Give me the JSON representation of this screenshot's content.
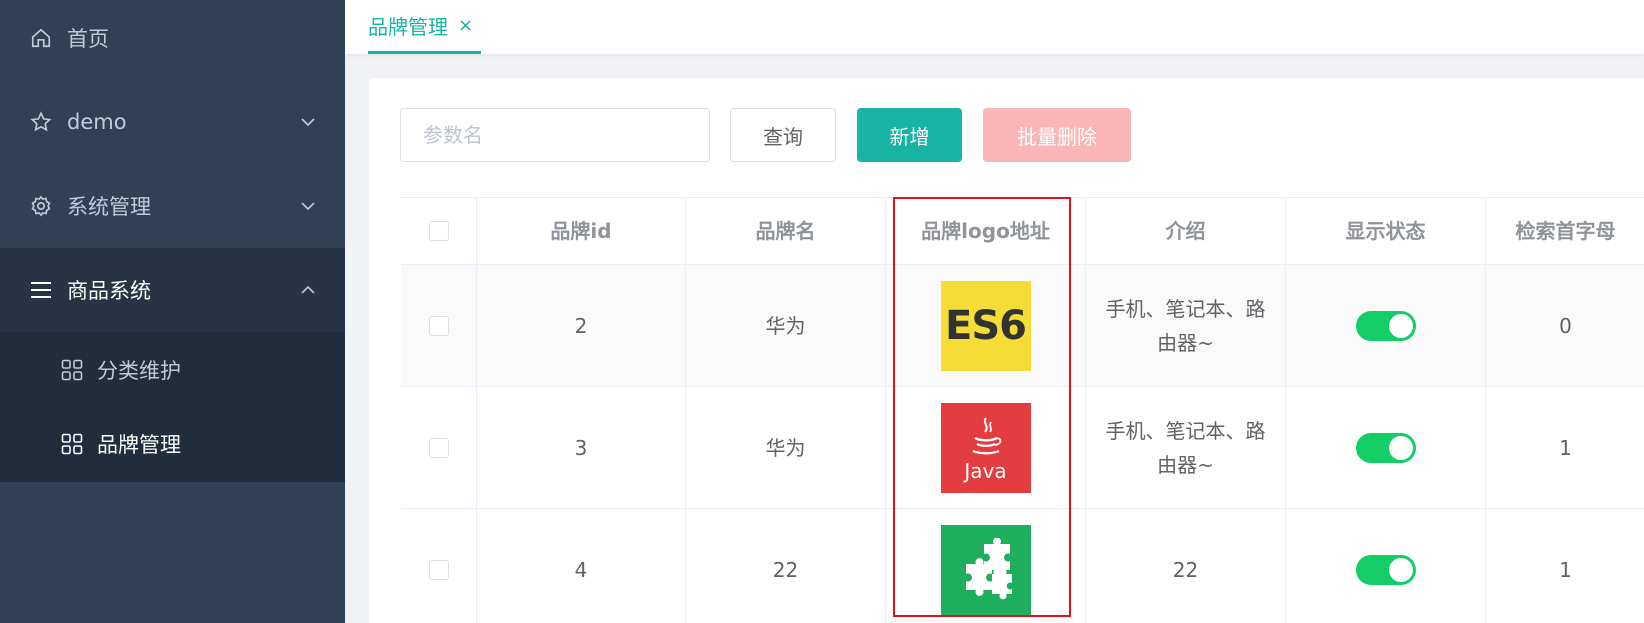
{
  "sidebar": {
    "items": [
      {
        "label": "首页",
        "icon": "home-icon"
      },
      {
        "label": "demo",
        "icon": "star-icon"
      },
      {
        "label": "系统管理",
        "icon": "gear-icon"
      },
      {
        "label": "商品系统",
        "icon": "menu-icon"
      }
    ],
    "subitems": [
      {
        "label": "分类维护",
        "icon": "grid-icon"
      },
      {
        "label": "品牌管理",
        "icon": "grid-icon"
      }
    ]
  },
  "tabs": [
    {
      "label": "品牌管理",
      "close": "×"
    }
  ],
  "toolbar": {
    "search_placeholder": "参数名",
    "query_label": "查询",
    "add_label": "新增",
    "batch_delete_label": "批量删除"
  },
  "table": {
    "headers": [
      "品牌id",
      "品牌名",
      "品牌logo地址",
      "介绍",
      "显示状态",
      "检索首字母"
    ],
    "rows": [
      {
        "id": "2",
        "name": "华为",
        "logo": "ES6",
        "intro": "手机、笔记本、路由器~",
        "show": true,
        "first_letter": "0"
      },
      {
        "id": "3",
        "name": "华为",
        "logo": "Java",
        "intro": "手机、笔记本、路由器~",
        "show": true,
        "first_letter": "1"
      },
      {
        "id": "4",
        "name": "22",
        "logo": "puzzle",
        "intro": "22",
        "show": true,
        "first_letter": "1"
      }
    ]
  },
  "colors": {
    "accent": "#17b3a3",
    "sidebar": "#304156",
    "switch_on": "#13ce66",
    "danger_light": "#fab6b6",
    "highlight": "#e0141e"
  }
}
